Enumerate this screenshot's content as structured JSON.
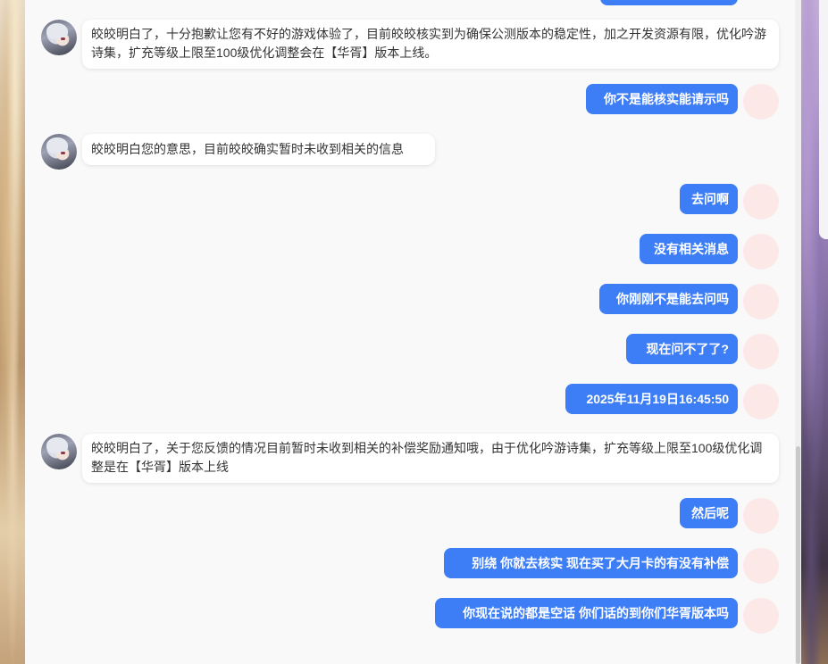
{
  "colors": {
    "user_bubble": "#3d7ef6",
    "bot_bubble": "#ffffff",
    "panel_bg": "#f9f9f9",
    "user_avatar": "#fde8e8"
  },
  "messages": [
    {
      "role": "bot",
      "text": "皎皎明白了，十分抱歉让您有不好的游戏体验了，目前皎皎核实到为确保公测版本的稳定性，加之开发资源有限，优化吟游诗集，扩充等级上限至100级优化调整会在【华胥】版本上线。"
    },
    {
      "role": "user",
      "text": "你不是能核实能请示吗"
    },
    {
      "role": "bot",
      "text": "皎皎明白您的意思，目前皎皎确实暂时未收到相关的信息"
    },
    {
      "role": "user",
      "text": "去问啊"
    },
    {
      "role": "user",
      "text": "没有相关消息"
    },
    {
      "role": "user",
      "text": "你刚刚不是能去问吗"
    },
    {
      "role": "user",
      "text": "现在问不了了?"
    },
    {
      "role": "user",
      "text": "2025年11月19日16:45:50"
    },
    {
      "role": "bot",
      "text": "皎皎明白了，关于您反馈的情况目前暂时未收到相关的补偿奖励通知哦，由于优化吟游诗集，扩充等级上限至100级优化调整是在【华胥】版本上线"
    },
    {
      "role": "user",
      "text": "然后呢"
    },
    {
      "role": "user",
      "text": "别绕 你就去核实 现在买了大月卡的有没有补偿"
    },
    {
      "role": "user",
      "text": "你现在说的都是空话 你们话的到你们华胥版本吗"
    }
  ]
}
